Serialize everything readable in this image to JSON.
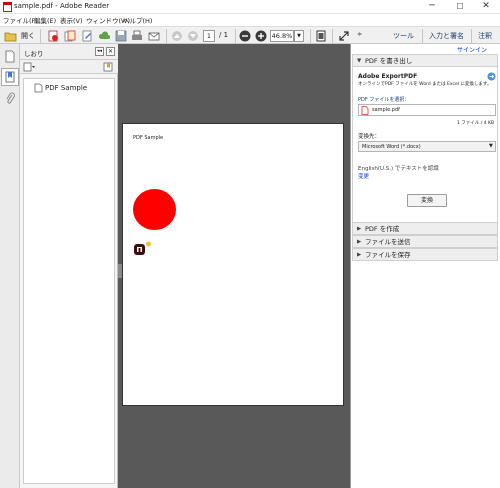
{
  "window": {
    "title": "sample.pdf - Adobe Reader",
    "controls": {
      "minimize": "─",
      "maximize": "☐",
      "close": "✕"
    }
  },
  "menu": {
    "items": [
      "ファイル(F)",
      "編集(E)",
      "表示(V)",
      "ウィンドウ(W)",
      "ヘルプ(H)"
    ]
  },
  "toolbar": {
    "open_label": "開く",
    "page_current": "1",
    "page_total": "/ 1",
    "zoom": "46.8%",
    "tools_tab": "ツール",
    "sign_tab": "入力と署名",
    "comment_tab": "注釈"
  },
  "bookmarks": {
    "header": "しおり",
    "items": [
      {
        "label": "PDF Sample"
      }
    ]
  },
  "document": {
    "page_heading": "PDF Sample",
    "circle_color": "#ff0000"
  },
  "right_pane": {
    "signin_link": "サインイン",
    "export_section": {
      "title": "PDF を書き出し",
      "service_name": "Adobe ExportPDF",
      "description": "オンラインでPDF ファイルを Word または Excel に変換します。",
      "select_file_label": "PDF ファイルを選択：",
      "selected_file": "sample.pdf",
      "file_info": "1 ファイル / 4 KB",
      "convert_to_label": "変換先：",
      "convert_to_value": "Microsoft Word (*.docx)",
      "ocr_text": "English(U.S.) でテキストを認識",
      "change_link": "変更",
      "convert_button": "変換"
    },
    "collapsed_sections": [
      "PDF を作成",
      "ファイルを送信",
      "ファイルを保存"
    ]
  },
  "colors": {
    "accent_blue": "#1a3d6e",
    "link_blue": "#0033cc",
    "doc_background": "#595959"
  }
}
